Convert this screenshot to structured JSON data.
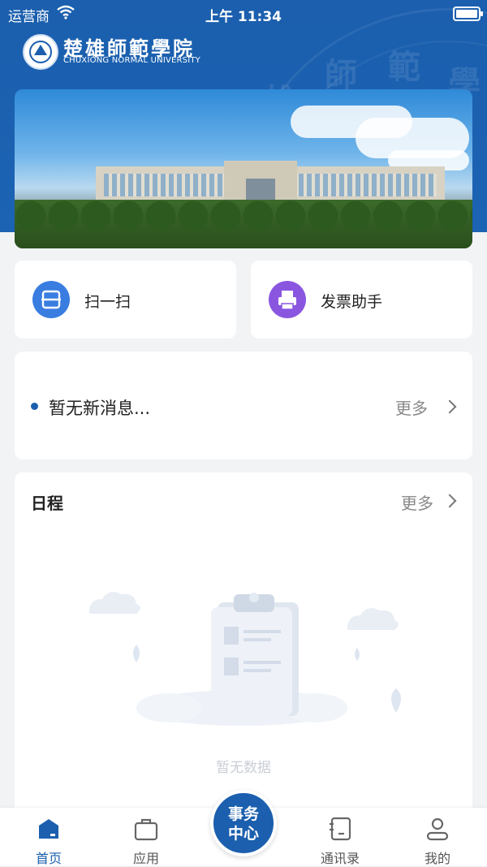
{
  "status_bar": {
    "carrier": "运营商",
    "time": "上午 11:34"
  },
  "header": {
    "school_name_cn": "楚雄師範學院",
    "school_name_en": "CHUXIONG NORMAL UNIVERSITY",
    "seal_chars": [
      "雄",
      "師",
      "範",
      "學"
    ]
  },
  "actions": [
    {
      "label": "扫一扫",
      "icon": "scan-icon",
      "color": "#3a7de0"
    },
    {
      "label": "发票助手",
      "icon": "printer-icon",
      "color": "#8a56e0"
    }
  ],
  "notice": {
    "message": "暂无新消息...",
    "more": "更多"
  },
  "schedule": {
    "title": "日程",
    "more": "更多",
    "empty_text": "暂无数据"
  },
  "tabbar": {
    "tabs": [
      {
        "label": "首页",
        "icon": "home-icon",
        "active": true
      },
      {
        "label": "应用",
        "icon": "briefcase-icon",
        "active": false
      },
      {
        "label": "通讯录",
        "icon": "contacts-icon",
        "active": false
      },
      {
        "label": "我的",
        "icon": "profile-icon",
        "active": false
      }
    ],
    "center": {
      "line1": "事务",
      "line2": "中心"
    }
  },
  "colors": {
    "primary": "#1b5fae",
    "background": "#f2f3f5"
  }
}
